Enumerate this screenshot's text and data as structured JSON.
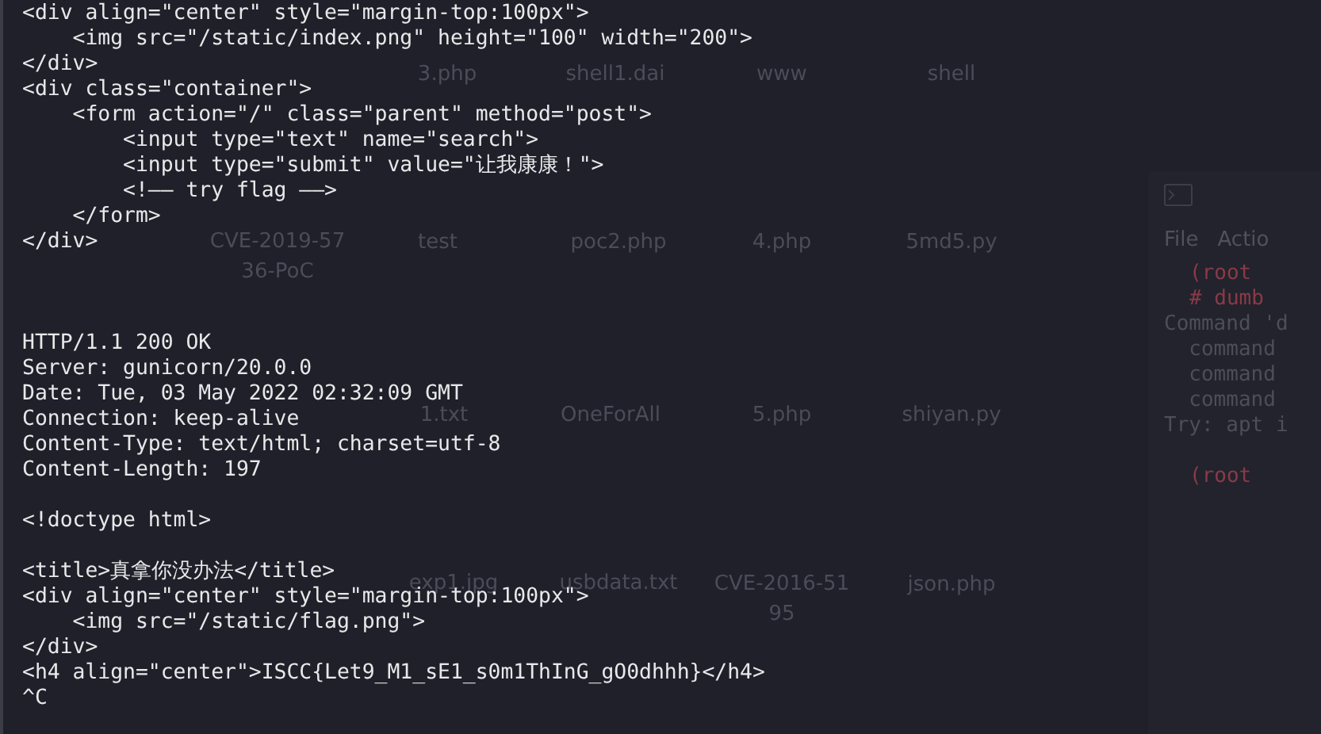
{
  "desktop": {
    "icons": [
      {
        "lines": [
          "3.php"
        ]
      },
      {
        "lines": [
          "shell1.dai"
        ]
      },
      {
        "lines": [
          "www"
        ]
      },
      {
        "lines": [
          "shell"
        ]
      },
      {
        "lines": [
          "CVE-2019-57",
          "36-PoC"
        ]
      },
      {
        "lines": [
          "test"
        ]
      },
      {
        "lines": [
          "poc2.php"
        ]
      },
      {
        "lines": [
          "4.php"
        ]
      },
      {
        "lines": [
          "5md5.py"
        ]
      },
      {
        "lines": [
          "1.txt"
        ]
      },
      {
        "lines": [
          "OneForAll"
        ]
      },
      {
        "lines": [
          "5.php"
        ]
      },
      {
        "lines": [
          "shiyan.py"
        ]
      },
      {
        "lines": [
          "exp1.jpg"
        ]
      },
      {
        "lines": [
          "usbdata.txt"
        ]
      },
      {
        "lines": [
          "CVE-2016-51",
          "95"
        ]
      },
      {
        "lines": [
          "json.php"
        ]
      }
    ]
  },
  "background_window": {
    "menu": [
      "File",
      "Actio"
    ],
    "lines": [
      {
        "kind": "prompt",
        "text": "(root"
      },
      {
        "kind": "prompt",
        "text": "# dumb"
      },
      {
        "kind": "output",
        "text": "Command 'd"
      },
      {
        "kind": "output",
        "text": "  command"
      },
      {
        "kind": "output",
        "text": "  command"
      },
      {
        "kind": "output",
        "text": "  command"
      },
      {
        "kind": "output",
        "text": "Try: apt i"
      },
      {
        "kind": "blank"
      },
      {
        "kind": "prompt",
        "text": "(root"
      }
    ]
  },
  "terminal": {
    "lines": [
      {
        "kind": "output",
        "text": "<div align=\"center\" style=\"margin-top:100px\">"
      },
      {
        "kind": "output",
        "text": "    <img src=\"/static/index.png\" height=\"100\" width=\"200\">"
      },
      {
        "kind": "output",
        "text": "</div>"
      },
      {
        "kind": "output",
        "text": "<div class=\"container\">"
      },
      {
        "kind": "output",
        "text": "    <form action=\"/\" class=\"parent\" method=\"post\">"
      },
      {
        "kind": "output",
        "text": "        <input type=\"text\" name=\"search\">"
      },
      {
        "kind": "output",
        "text": "        <input type=\"submit\" value=\"让我康康！\">"
      },
      {
        "kind": "output",
        "text": "        <!—— try flag ——>"
      },
      {
        "kind": "output",
        "text": "    </form>"
      },
      {
        "kind": "output",
        "text": "</div>"
      },
      {
        "kind": "blank"
      },
      {
        "kind": "blank"
      },
      {
        "kind": "blank"
      },
      {
        "kind": "output",
        "text": "HTTP/1.1 200 OK"
      },
      {
        "kind": "output",
        "text": "Server: gunicorn/20.0.0"
      },
      {
        "kind": "output",
        "text": "Date: Tue, 03 May 2022 02:32:09 GMT"
      },
      {
        "kind": "output",
        "text": "Connection: keep-alive"
      },
      {
        "kind": "output",
        "text": "Content-Type: text/html; charset=utf-8"
      },
      {
        "kind": "output",
        "text": "Content-Length: 197"
      },
      {
        "kind": "blank"
      },
      {
        "kind": "output",
        "text": "<!doctype html>"
      },
      {
        "kind": "blank"
      },
      {
        "kind": "output",
        "text": "<title>真拿你没办法</title>"
      },
      {
        "kind": "output",
        "text": "<div align=\"center\" style=\"margin-top:100px\">"
      },
      {
        "kind": "output",
        "text": "    <img src=\"/static/flag.png\">"
      },
      {
        "kind": "output",
        "text": "</div>"
      },
      {
        "kind": "output",
        "text": "<h4 align=\"center\">ISCC{Let9_M1_sE1_s0m1ThInG_gO0dhhh}</h4>"
      },
      {
        "kind": "output",
        "text": "^C"
      }
    ]
  }
}
